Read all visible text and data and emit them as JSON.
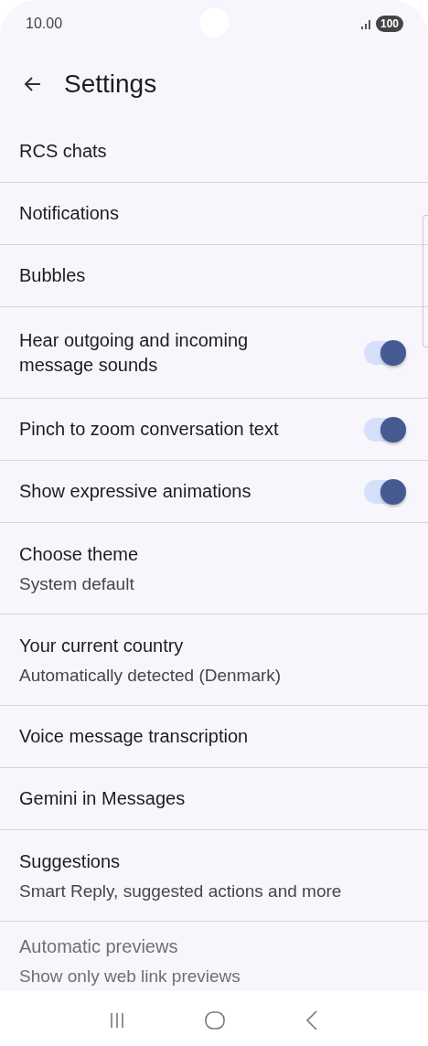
{
  "status_bar": {
    "time": "10.00",
    "battery": "100"
  },
  "header": {
    "title": "Settings"
  },
  "items": [
    {
      "kind": "plain",
      "title": "RCS chats"
    },
    {
      "kind": "plain",
      "title": "Notifications"
    },
    {
      "kind": "plain",
      "title": "Bubbles"
    },
    {
      "kind": "toggle",
      "title": "Hear outgoing and incoming message sounds",
      "on": true
    },
    {
      "kind": "toggle",
      "title": "Pinch to zoom conversation text",
      "on": true
    },
    {
      "kind": "toggle",
      "title": "Show expressive animations",
      "on": true
    },
    {
      "kind": "plain",
      "title": "Choose theme",
      "subtitle": "System default"
    },
    {
      "kind": "plain",
      "title": "Your current country",
      "subtitle": "Automatically detected (Denmark)"
    },
    {
      "kind": "plain",
      "title": "Voice message transcription"
    },
    {
      "kind": "plain",
      "title": "Gemini in Messages"
    },
    {
      "kind": "plain",
      "title": "Suggestions",
      "subtitle": "Smart Reply, suggested actions and more"
    },
    {
      "kind": "plain",
      "title": "Automatic previews",
      "subtitle": "Show only web link previews"
    }
  ]
}
